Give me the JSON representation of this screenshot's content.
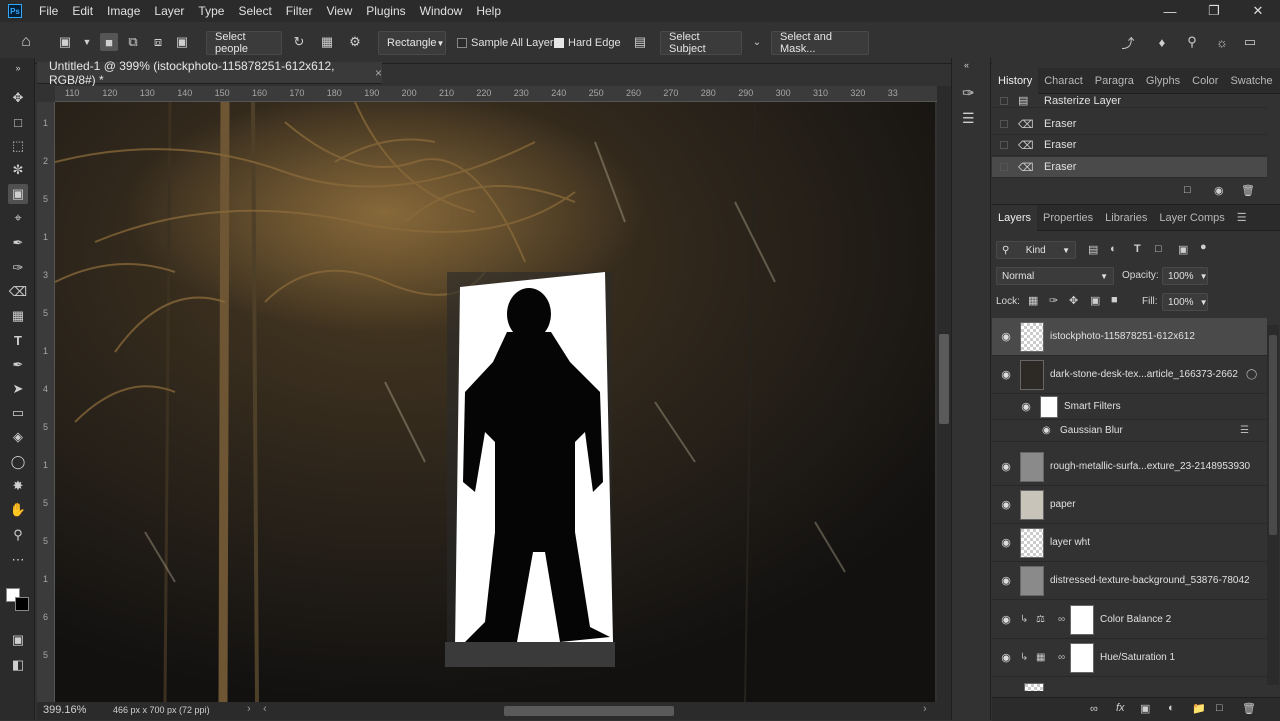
{
  "app": {
    "logo": "Ps"
  },
  "menu": [
    "File",
    "Edit",
    "Image",
    "Layer",
    "Type",
    "Select",
    "Filter",
    "View",
    "Plugins",
    "Window",
    "Help"
  ],
  "options": {
    "select_people": "Select people",
    "mode_select": "Rectangle",
    "sample_all_layers": "Sample All Layers",
    "hard_edge": "Hard Edge",
    "select_subject": "Select Subject",
    "select_and_mask": "Select and Mask..."
  },
  "document": {
    "tab_title": "Untitled-1 @ 399% (istockphoto-115878251-612x612, RGB/8#) *",
    "zoom": "399.16%",
    "size_info": "466 px x 700 px (72 ppi)"
  },
  "ruler": {
    "h": [
      "110",
      "120",
      "130",
      "140",
      "150",
      "160",
      "170",
      "180",
      "190",
      "200",
      "210",
      "220",
      "230",
      "240",
      "250",
      "260",
      "270",
      "280",
      "290",
      "300",
      "310",
      "320",
      "33"
    ],
    "v": [
      "1",
      "2",
      "5",
      "1",
      "3",
      "5",
      "1",
      "4",
      "5",
      "1",
      "5",
      "5",
      "1",
      "6",
      "5"
    ]
  },
  "history": {
    "tabs": [
      "History",
      "Charact",
      "Paragra",
      "Glyphs",
      "Color",
      "Swatche"
    ],
    "items": [
      {
        "label": "Rasterize Layer",
        "icon": "layer-icon"
      },
      {
        "label": "Eraser",
        "icon": "eraser-icon"
      },
      {
        "label": "Eraser",
        "icon": "eraser-icon"
      },
      {
        "label": "Eraser",
        "icon": "eraser-icon"
      }
    ]
  },
  "layers": {
    "tabs": [
      "Layers",
      "Properties",
      "Libraries",
      "Layer Comps"
    ],
    "filter_kind": "Kind",
    "blend_mode": "Normal",
    "opacity_label": "Opacity:",
    "opacity": "100%",
    "lock_label": "Lock:",
    "fill_label": "Fill:",
    "fill": "100%",
    "items": [
      {
        "name": "istockphoto-115878251-612x612",
        "thumb": "checker",
        "selected": true
      },
      {
        "name": "dark-stone-desk-tex...article_166373-2662",
        "thumb": "dark"
      },
      {
        "name": "Smart Filters",
        "thumb": "white",
        "sub": true
      },
      {
        "name": "Gaussian Blur",
        "thumb": "none",
        "sub2": true
      },
      {
        "name": "rough-metallic-surfa...exture_23-2148953930",
        "thumb": "grey"
      },
      {
        "name": "paper",
        "thumb": "paper"
      },
      {
        "name": "layer wht",
        "thumb": "checker"
      },
      {
        "name": "distressed-texture-background_53876-78042",
        "thumb": "grey"
      },
      {
        "name": "Color Balance 2",
        "thumb": "white",
        "adj": true
      },
      {
        "name": "Hue/Saturation 1",
        "thumb": "white",
        "adj": true
      }
    ]
  }
}
